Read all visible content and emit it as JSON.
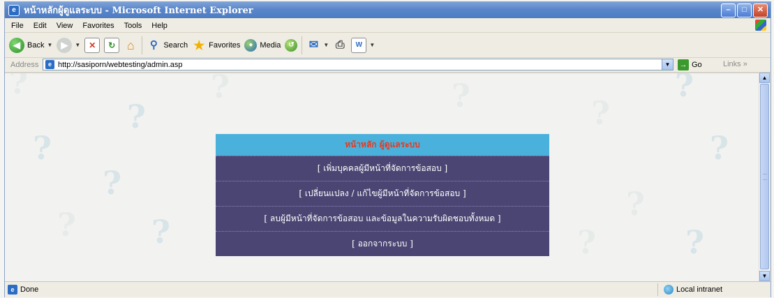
{
  "window": {
    "title": "หน้าหลักผู้ดูแลระบบ - Microsoft Internet Explorer",
    "icon": "ie-icon",
    "controls": [
      "minimize",
      "maximize",
      "close"
    ]
  },
  "menubar": {
    "items": [
      {
        "label": "File"
      },
      {
        "label": "Edit"
      },
      {
        "label": "View"
      },
      {
        "label": "Favorites"
      },
      {
        "label": "Tools"
      },
      {
        "label": "Help"
      }
    ]
  },
  "toolbar": {
    "back_label": "Back",
    "search_label": "Search",
    "favorites_label": "Favorites",
    "media_label": "Media"
  },
  "addressbar": {
    "label": "Address",
    "url": "http://sasiporn/webtesting/admin.asp",
    "go_label": "Go",
    "links_label": "Links"
  },
  "admin_menu": {
    "header": "หน้าหลัก ผู้ดูแลระบบ",
    "items": [
      {
        "label": "[ เพิ่มบุคคลผู้มีหน้าที่จัดการข้อสอบ ]"
      },
      {
        "label": "[ เปลี่ยนแปลง / แก้ไขผู้มีหน้าที่จัดการข้อสอบ ]"
      },
      {
        "label": "[ ลบผู้มีหน้าที่จัดการข้อสอบ และข้อมูลในความรับผิดชอบทั้งหมด ]"
      },
      {
        "label": "[ ออกจากระบบ ]"
      }
    ]
  },
  "statusbar": {
    "status": "Done",
    "zone": "Local intranet"
  },
  "colors": {
    "header_bg": "#4ab1dc",
    "header_text": "#e53b21",
    "row_bg": "#4a4573",
    "row_text": "#ffffff"
  }
}
